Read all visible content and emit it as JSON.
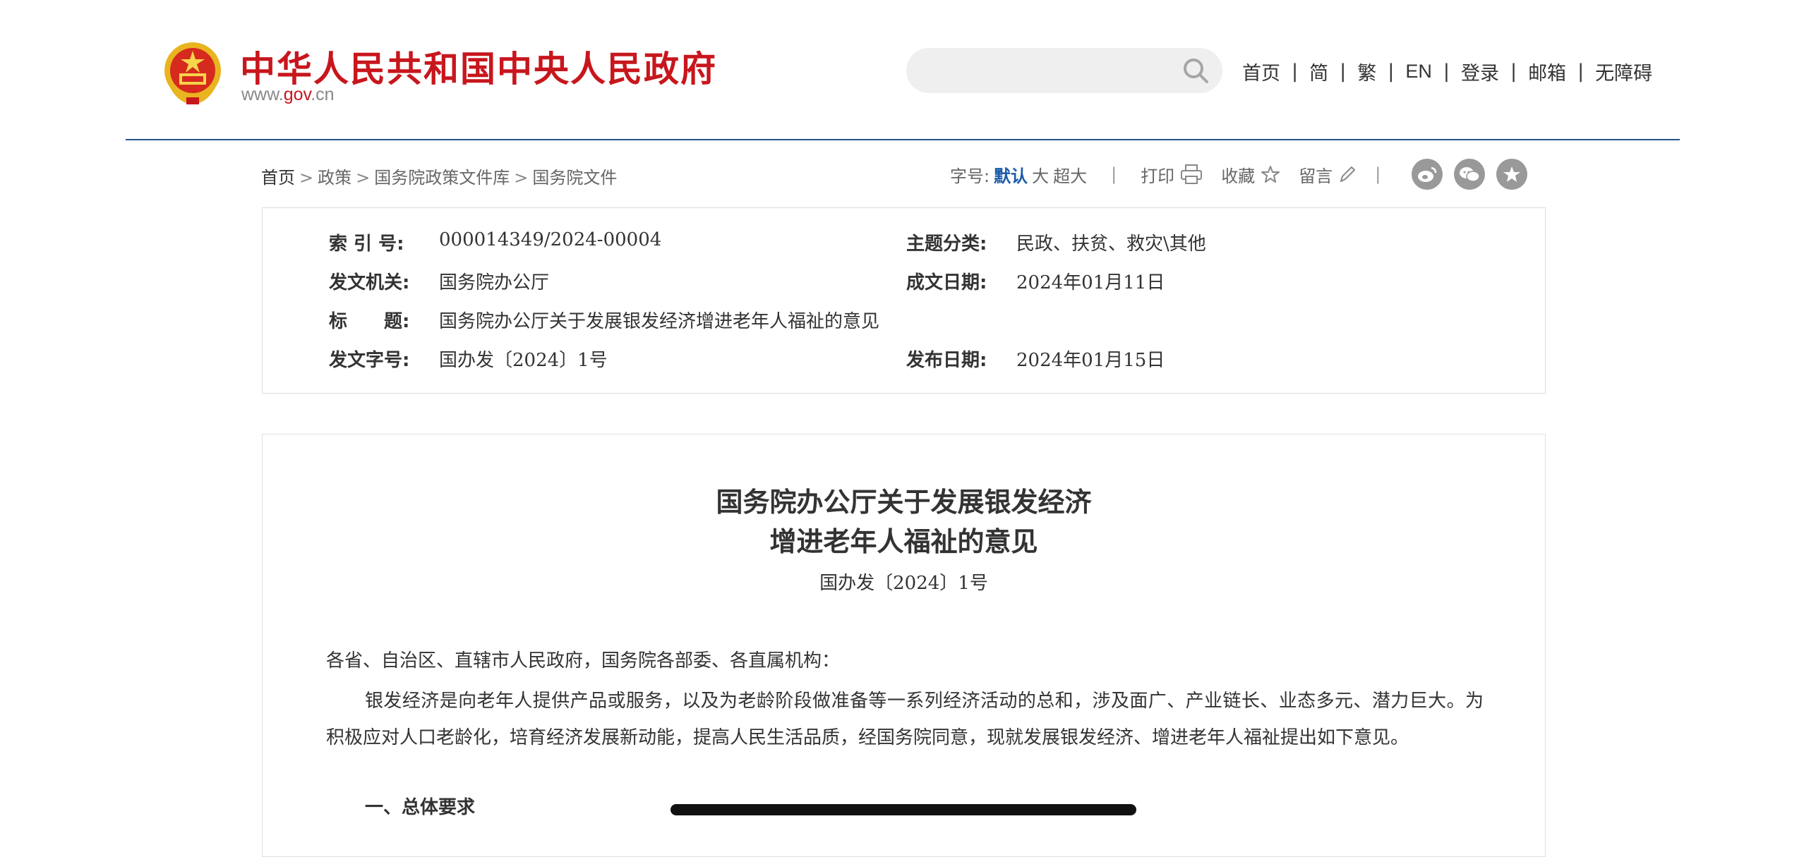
{
  "header": {
    "site_name": "中华人民共和国中央人民政府",
    "site_url_prefix": "www.",
    "site_url_brand": "gov",
    "site_url_suffix": ".cn",
    "search_placeholder": "",
    "nav": [
      "首页",
      "简",
      "繁",
      "EN",
      "登录",
      "邮箱",
      "无障碍"
    ],
    "nav_separator": "|"
  },
  "breadcrumb": {
    "items": [
      "首页",
      "政策",
      "国务院政策文件库",
      "国务院文件"
    ],
    "separator": ">"
  },
  "tools": {
    "font_size_label": "字号:",
    "font_default": "默认",
    "font_large": "大",
    "font_xlarge": "超大",
    "print_label": "打印",
    "favorite_label": "收藏",
    "comment_label": "留言",
    "separator": "|"
  },
  "info": {
    "index_label": "索 引 号:",
    "index_value": "000014349/2024-00004",
    "topic_label": "主题分类:",
    "topic_value": "民政、扶贫、救灾\\其他",
    "issuer_label": "发文机关:",
    "issuer_value": "国务院办公厅",
    "created_label": "成文日期:",
    "created_value": "2024年01月11日",
    "title_label": "标　　题:",
    "title_value": "国务院办公厅关于发展银发经济增进老年人福祉的意见",
    "doc_no_label": "发文字号:",
    "doc_no_value": "国办发〔2024〕1号",
    "published_label": "发布日期:",
    "published_value": "2024年01月15日"
  },
  "article": {
    "title_line1": "国务院办公厅关于发展银发经济",
    "title_line2": "增进老年人福祉的意见",
    "doc_no": "国办发〔2024〕1号",
    "salutation": "各省、自治区、直辖市人民政府，国务院各部委、各直属机构：",
    "paragraph1": "银发经济是向老年人提供产品或服务，以及为老龄阶段做准备等一系列经济活动的总和，涉及面广、产业链长、业态多元、潜力巨大。为积极应对人口老龄化，培育经济发展新动能，提高人民生活品质，经国务院同意，现就发展银发经济、增进老年人福祉提出如下意见。",
    "section1_heading": "一、总体要求"
  },
  "colors": {
    "brand_red": "#c8161d",
    "header_rule": "#2a5285",
    "active_blue": "#1a5aa8"
  }
}
